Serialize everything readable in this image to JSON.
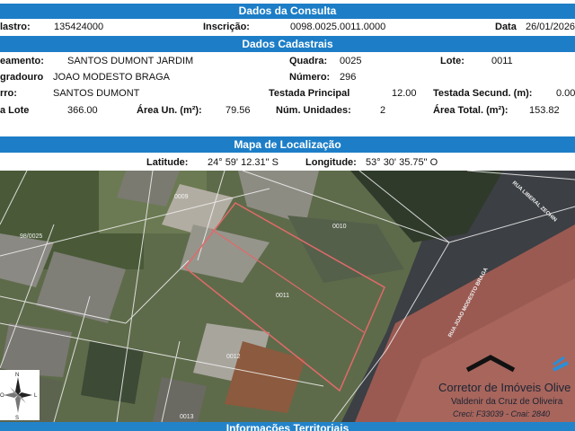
{
  "header1": {
    "title": "Dados da Consulta"
  },
  "consulta": {
    "cadastro_label": "lastro:",
    "cadastro_value": "135424000",
    "inscricao_label": "Inscrição:",
    "inscricao_value": "0098.0025.0011.0000",
    "data_label": "Data",
    "data_value": "26/01/2026"
  },
  "header2": {
    "title": "Dados Cadastrais"
  },
  "cadastrais": {
    "loteamento_label": "eamento:",
    "loteamento_value": "SANTOS DUMONT JARDIM",
    "quadra_label": "Quadra:",
    "quadra_value": "0025",
    "lote_label": "Lote:",
    "lote_value": "0011",
    "logradouro_label": "gradouro",
    "logradouro_value": "JOAO MODESTO BRAGA",
    "numero_label": "Número:",
    "numero_value": "296",
    "bairro_label": "rro:",
    "bairro_value": "SANTOS DUMONT",
    "testada_label": "Testada Principal",
    "testada_value": "12.00",
    "testada_sec_label": "Testada Secund. (m):",
    "testada_sec_value": "0.00",
    "area_lote_label": "a Lote",
    "area_lote_value": "366.00",
    "area_un_label": "Área Un. (m²):",
    "area_un_value": "79.56",
    "num_unidades_label": "Núm. Unidades:",
    "num_unidades_value": "2",
    "area_total_label": "Área Total. (m²):",
    "area_total_value": "153.82"
  },
  "header3": {
    "title": "Mapa de Localização"
  },
  "localizacao": {
    "latitude_label": "Latitude:",
    "latitude_value": "24° 59' 12.31\" S",
    "longitude_label": "Longitude:",
    "longitude_value": "53° 30' 35.75\" O"
  },
  "map": {
    "lot_labels": [
      "0009",
      "0010",
      "98/0025",
      "0011",
      "0012",
      "0013"
    ],
    "street_labels": [
      "RUA LIBERAL ZECHIN",
      "RUA JOAO MODESTO BRAGA"
    ],
    "compass_letters": [
      "N",
      "S",
      "L",
      "O"
    ],
    "highlight_color": "#e06a6a"
  },
  "watermark": {
    "line1": "Corretor de Imóveis Olive",
    "line2": "Valdenir da Cruz de Oliveira",
    "line3": "Creci: F33039 - Cnai: 2840"
  },
  "footer": {
    "title": "Informações Territoriais"
  },
  "colors": {
    "header_bg": "#1d7ec7",
    "header_text": "#ffffff"
  }
}
